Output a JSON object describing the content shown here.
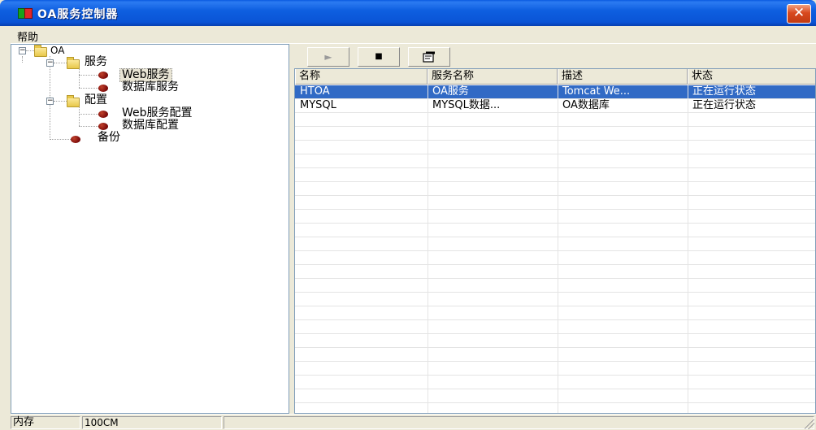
{
  "window": {
    "title": "OA服务控制器",
    "close_glyph": "✕"
  },
  "menu": {
    "items": [
      {
        "label": "帮助"
      }
    ]
  },
  "tree": {
    "root": "OA",
    "groups": [
      {
        "label": "服务",
        "children": [
          "Web服务",
          "数据库服务"
        ]
      },
      {
        "label": "配置",
        "children": [
          "Web服务配置",
          "数据库配置"
        ]
      }
    ],
    "leaf": "备份",
    "selected": "Web服务"
  },
  "toolbar": {
    "buttons": [
      {
        "icon": "play-icon",
        "glyph": "►"
      },
      {
        "icon": "stop-icon",
        "glyph": "■"
      },
      {
        "icon": "properties-icon",
        "glyph": ""
      }
    ]
  },
  "table": {
    "columns": [
      "名称",
      "服务名称",
      "描述",
      "状态"
    ],
    "rows": [
      [
        "HTOA",
        "OA服务",
        "Tomcat We...",
        "正在运行状态"
      ],
      [
        "MYSQL",
        "MYSQL数据...",
        "OA数据库",
        "正在运行状态"
      ]
    ],
    "selected_row": 0
  },
  "status": {
    "label": "内存",
    "value": "100CM"
  },
  "colors": {
    "selection": "#316ac5",
    "title_bar": "#0a54d6",
    "background": "#ece9d8"
  }
}
